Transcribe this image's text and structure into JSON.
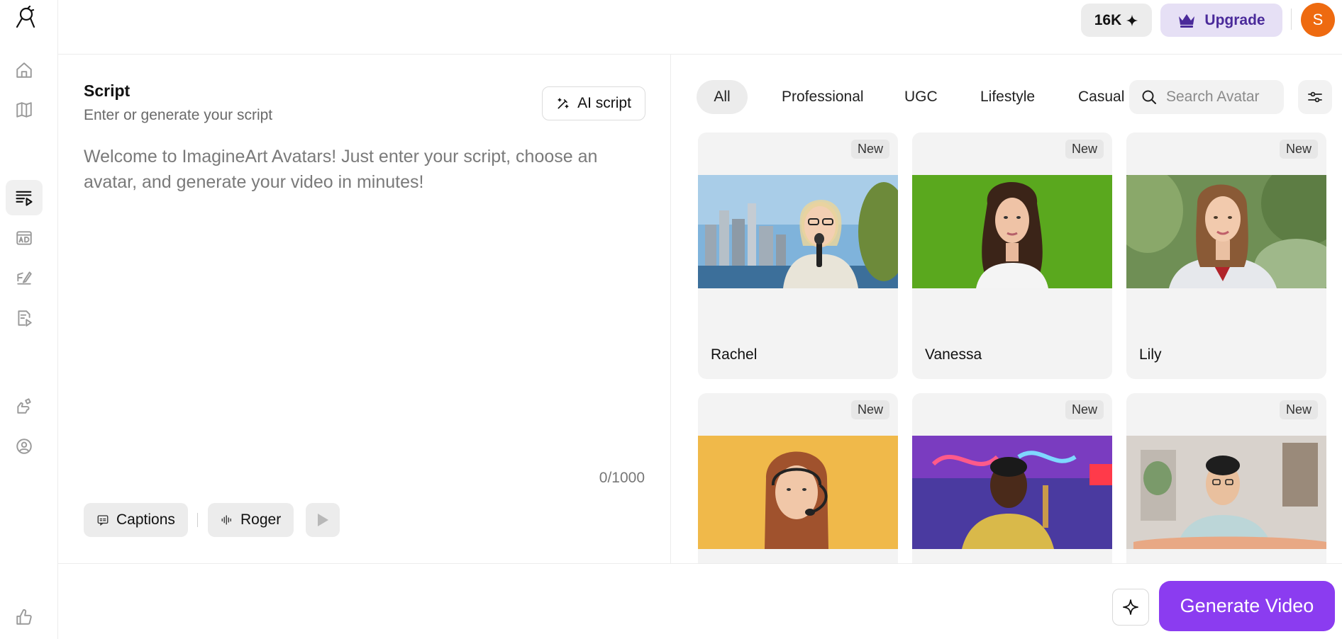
{
  "header": {
    "credits": "16K",
    "upgrade_label": "Upgrade",
    "avatar_initial": "S",
    "avatar_color": "#EE6A10",
    "upgrade_bg": "#E6E0F5"
  },
  "sidebar": {
    "items": [
      {
        "icon": "home-icon"
      },
      {
        "icon": "book-icon"
      },
      {
        "icon": "script-video-icon",
        "active": true
      },
      {
        "icon": "ad-icon"
      },
      {
        "icon": "edit-doc-icon"
      },
      {
        "icon": "doc-play-icon"
      },
      {
        "icon": "hand-icon"
      },
      {
        "icon": "user-circle-icon"
      },
      {
        "icon": "thumbs-up-icon"
      }
    ]
  },
  "script": {
    "title": "Script",
    "subtitle": "Enter or generate your script",
    "ai_script_label": "AI script",
    "placeholder": "Welcome to ImagineArt Avatars! Just enter your script, choose an avatar, and generate your video in minutes!",
    "counter": "0/1000",
    "captions_label": "Captions",
    "voice_label": "Roger"
  },
  "avatars": {
    "tabs": [
      "All",
      "Professional",
      "UGC",
      "Lifestyle",
      "Casual"
    ],
    "active_tab": "All",
    "search_placeholder": "Search Avatar",
    "cards": [
      {
        "name": "Rachel",
        "badge": "New"
      },
      {
        "name": "Vanessa",
        "badge": "New"
      },
      {
        "name": "Lily",
        "badge": "New"
      },
      {
        "name": "",
        "badge": "New"
      },
      {
        "name": "",
        "badge": "New"
      },
      {
        "name": "",
        "badge": "New"
      }
    ]
  },
  "footer": {
    "generate_label": "Generate Video",
    "accent": "#8B3CF0"
  }
}
